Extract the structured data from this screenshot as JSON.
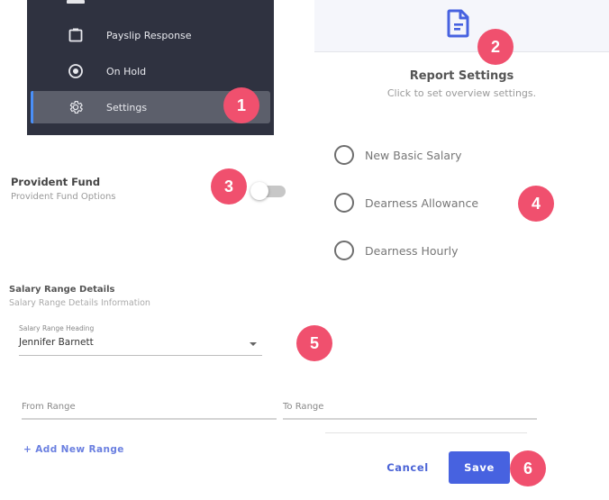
{
  "sidebar": {
    "items": [
      {
        "label": "Payslip Response",
        "icon": "clipboard-icon",
        "active": false
      },
      {
        "label": "On Hold",
        "icon": "radio-dot-icon",
        "active": false
      },
      {
        "label": "Settings",
        "icon": "gear-icon",
        "active": true
      }
    ]
  },
  "report_settings": {
    "icon": "document-icon",
    "title": "Report Settings",
    "subtitle": "Click to set overview settings."
  },
  "provident_fund": {
    "title": "Provident Fund",
    "subtitle": "Provident Fund Options",
    "toggle_on": false
  },
  "options": [
    {
      "label": "New Basic Salary",
      "selected": false
    },
    {
      "label": "Dearness Allowance",
      "selected": false
    },
    {
      "label": "Dearness Hourly",
      "selected": false
    }
  ],
  "salary_range": {
    "title": "Salary Range Details",
    "subtitle": "Salary Range Details Information",
    "heading_label": "Salary Range Heading",
    "heading_value": "Jennifer Barnett",
    "from_placeholder": "From Range",
    "to_placeholder": "To Range",
    "add_label": "+ Add New Range"
  },
  "actions": {
    "cancel": "Cancel",
    "save": "Save"
  },
  "badges": [
    "1",
    "2",
    "3",
    "4",
    "5",
    "6"
  ],
  "colors": {
    "accent": "#4762e0",
    "badge": "#f0506e",
    "sidebar_bg": "#2f3240",
    "sidebar_active_indicator": "#4a8ff7"
  }
}
